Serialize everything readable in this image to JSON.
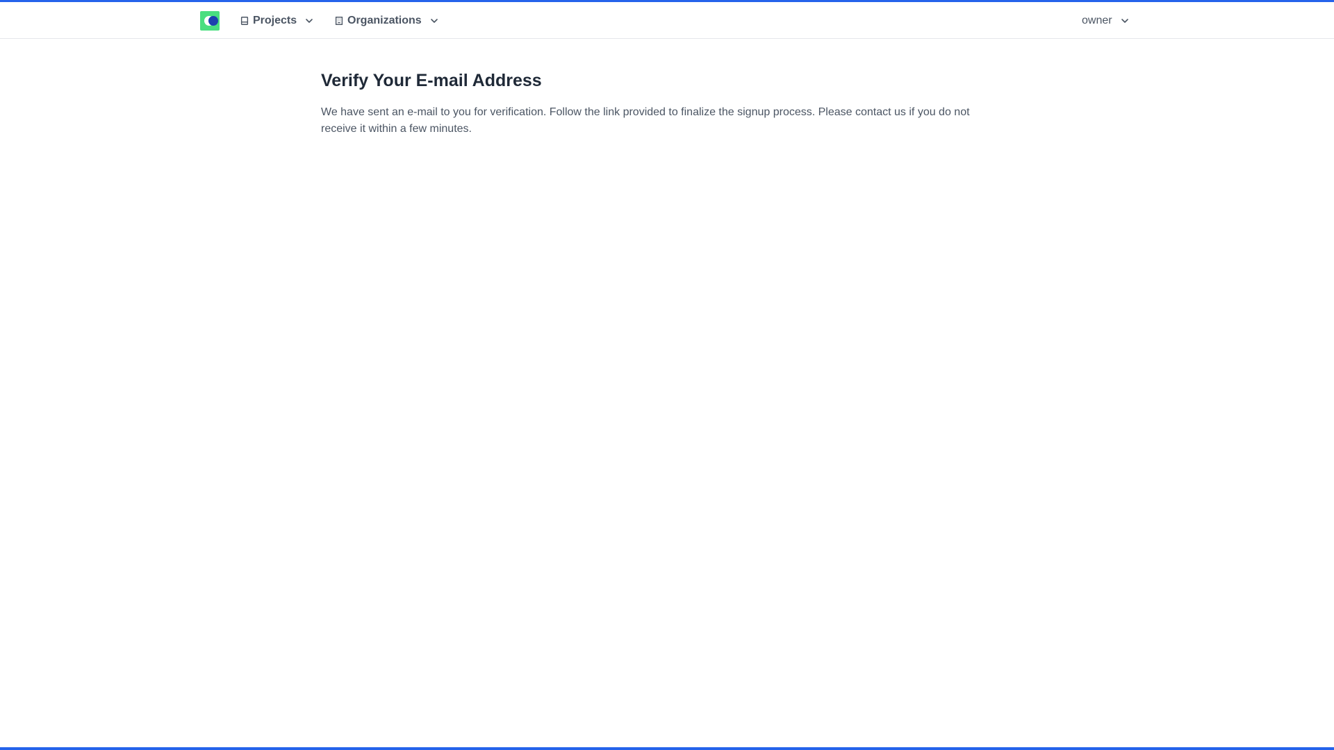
{
  "header": {
    "logo_alt": "logo",
    "nav": {
      "projects_label": "Projects",
      "organizations_label": "Organizations"
    },
    "user": {
      "name": "owner"
    }
  },
  "main": {
    "title": "Verify Your E-mail Address",
    "message": "We have sent an e-mail to you for verification. Follow the link provided to finalize the signup process. Please contact us if you do not receive it within a few minutes."
  },
  "colors": {
    "accent": "#2563eb",
    "logo_bg": "#4ade80",
    "logo_mark": "#1e40af"
  },
  "icons": {
    "projects": "book-icon",
    "organizations": "building-icon",
    "dropdown": "chevron-down-icon"
  }
}
